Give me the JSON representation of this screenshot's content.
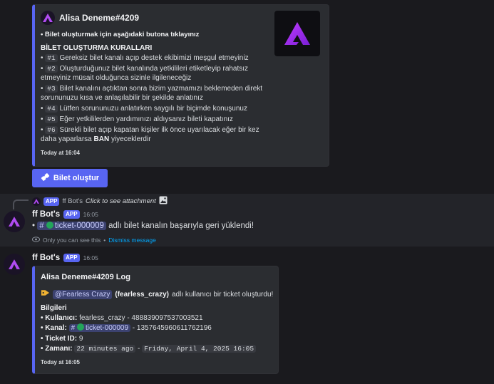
{
  "embed1": {
    "author": "Alisa Deneme#4209",
    "intro": "• Bilet oluşturmak için aşağıdaki butona tıklayınız",
    "rules_title": "BİLET OLUŞTURMA KURALLARI",
    "rules": [
      {
        "tag": "#1",
        "line1": "Gereksiz bilet kanalı açıp destek ekibimizi meşgul etmeyiniz",
        "line2": ""
      },
      {
        "tag": "#2",
        "line1": "Oluşturduğunuz bilet kanalında yetkilileri etiketleyip rahatsız",
        "line2": "etmeyiniz müsait olduğunca sizinle ilgileneceğiz"
      },
      {
        "tag": "#3",
        "line1": "Bilet kanalını açtıktan sonra bizim yazmamızı beklemeden direkt",
        "line2": "sorununuzu kısa ve anlaşılabilir bir şekilde anlatınız"
      },
      {
        "tag": "#4",
        "line1": "Lütfen sorununuzu anlatırken saygılı bir biçimde konuşunuz",
        "line2": ""
      },
      {
        "tag": "#5",
        "line1": "Eğer yetkililerden yardımınızı aldıysanız bileti kapatınız",
        "line2": ""
      },
      {
        "tag": "#6",
        "line1": "Sürekli bilet açıp kapatan kişiler ilk önce uyarılacak eğer bir kez",
        "line2_pre": "daha yaparlarsa ",
        "line2_bold": "BAN",
        "line2_post": " yiyeceklerdir"
      }
    ],
    "footer": "Today at 16:04"
  },
  "button": {
    "label": "Bilet oluştur",
    "icon": "ticket-icon"
  },
  "reply": {
    "username": "ff Bot's",
    "badge": "APP",
    "text": "Click to see attachment",
    "icon": "image-icon"
  },
  "message1": {
    "username": "ff Bot's",
    "badge": "APP",
    "time": "16:05",
    "channel_hash": "#",
    "channel": "ticket-000009",
    "text": "adlı bilet kanalın başarıyla geri yüklendi!",
    "ephemeral_note": "Only you can see this",
    "separator": "•",
    "dismiss": "Dismiss message"
  },
  "message2": {
    "username": "ff Bot's",
    "badge": "APP",
    "time": "16:05"
  },
  "embed2": {
    "title": "Alisa Deneme#4209 Log",
    "mention": "@Fearless Crazy",
    "mention_user": "(fearless_crazy)",
    "line_text": "adlı kullanıcı bir ticket oluşturdu!",
    "info_title": "Bilgileri",
    "user_label": "• Kullanıcı:",
    "user_value": "fearless_crazy - 488839097537003521",
    "channel_label": "• Kanal:",
    "channel_hash": "#",
    "channel_name": "ticket-000009",
    "channel_id": "- 1357645960611762196",
    "ticket_label": "• Ticket ID:",
    "ticket_value": "9",
    "time_label": "• Zamanı:",
    "time_rel": "22 minutes ago",
    "time_sep": "-",
    "time_abs": "Friday, April 4, 2025 16:05",
    "footer": "Today at 16:05"
  },
  "colors": {
    "accent": "#5865f2",
    "brand": "#a020f0",
    "background": "#1a1a1e"
  }
}
